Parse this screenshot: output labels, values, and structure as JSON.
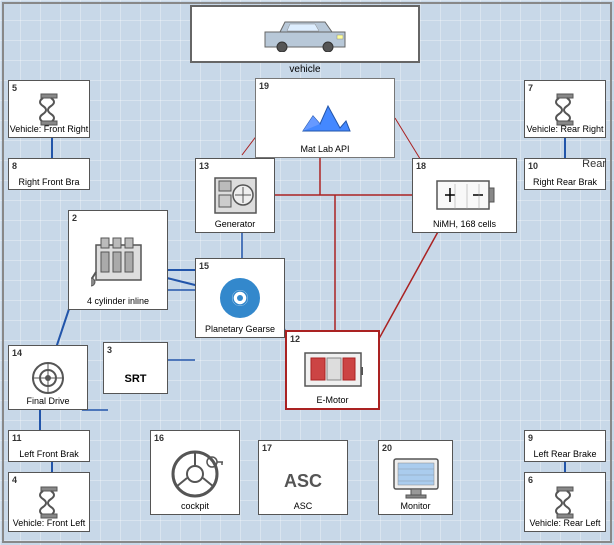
{
  "title": "vehicle",
  "blocks": {
    "vehicle_top": {
      "label": "vehicle",
      "number": ""
    },
    "vehicle_front_right": {
      "label": "Vehicle: Front Right",
      "number": "5"
    },
    "vehicle_rear_right": {
      "label": "Vehicle: Rear Right",
      "number": "7"
    },
    "vehicle_front_left": {
      "label": "Vehicle: Front Left",
      "number": "4"
    },
    "vehicle_rear_left": {
      "label": "Vehicle: Rear Left",
      "number": "6"
    },
    "right_front_brake": {
      "label": "Right Front Bra",
      "number": "8"
    },
    "right_rear_brake": {
      "label": "Right Rear Brak",
      "number": "10"
    },
    "left_front_brake": {
      "label": "Left Front Brak",
      "number": "11"
    },
    "left_rear_brake": {
      "label": "Left Rear Brake",
      "number": "9"
    },
    "cylinder": {
      "label": "4 cylinder inline",
      "number": "2"
    },
    "generator": {
      "label": "Generator",
      "number": "13"
    },
    "planetary_gearse": {
      "label": "Planetary Gearse",
      "number": "15"
    },
    "emoror": {
      "label": "E-Motor",
      "number": "12"
    },
    "nimh": {
      "label": "NiMH, 168 cells",
      "number": "18"
    },
    "matlab_api": {
      "label": "Mat Lab API",
      "number": "19"
    },
    "final_drive": {
      "label": "Final Drive",
      "number": "14"
    },
    "srt": {
      "label": "SRT",
      "number": "3"
    },
    "asc": {
      "label": "ASC",
      "number": "17"
    },
    "cockpit": {
      "label": "cockpit",
      "number": "16"
    },
    "monitor": {
      "label": "Monitor",
      "number": "20"
    },
    "rear_label": {
      "label": "Rear"
    }
  },
  "colors": {
    "background": "#c8d8e8",
    "block_border": "#555555",
    "line_blue": "#2255aa",
    "line_red": "#aa2222",
    "line_dark": "#333333"
  }
}
